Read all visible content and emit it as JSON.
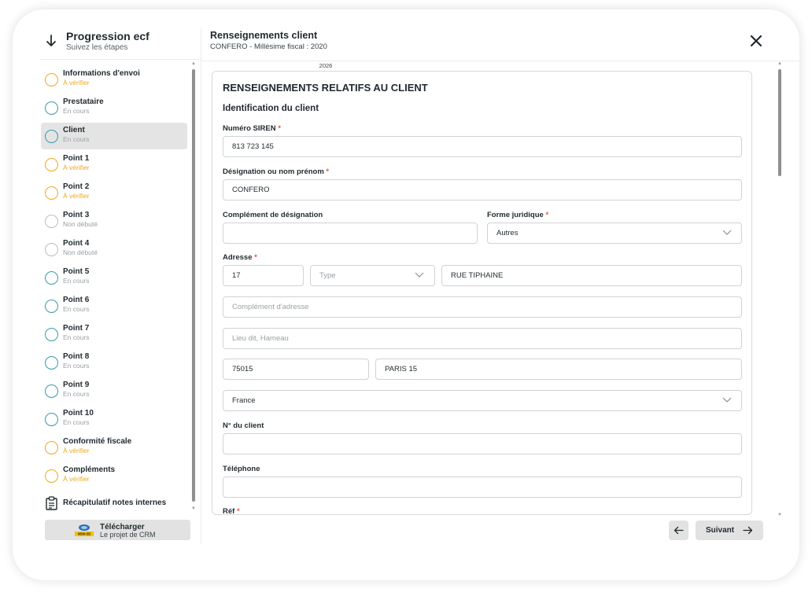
{
  "sidebar": {
    "title": "Progression ecf",
    "subtitle": "Suivez les étapes",
    "steps": [
      {
        "label": "Informations d'envoi",
        "status": "À vérifier",
        "state": "orange"
      },
      {
        "label": "Prestataire",
        "status": "En cours",
        "state": "teal"
      },
      {
        "label": "Client",
        "status": "En cours",
        "state": "teal",
        "active": true
      },
      {
        "label": "Point 1",
        "status": "À vérifier",
        "state": "orange"
      },
      {
        "label": "Point 2",
        "status": "À vérifier",
        "state": "orange"
      },
      {
        "label": "Point 3",
        "status": "Non débuté",
        "state": "grey"
      },
      {
        "label": "Point 4",
        "status": "Non débuté",
        "state": "grey"
      },
      {
        "label": "Point 5",
        "status": "En cours",
        "state": "teal"
      },
      {
        "label": "Point 6",
        "status": "En cours",
        "state": "teal"
      },
      {
        "label": "Point 7",
        "status": "En cours",
        "state": "teal"
      },
      {
        "label": "Point 8",
        "status": "En cours",
        "state": "teal"
      },
      {
        "label": "Point 9",
        "status": "En cours",
        "state": "teal"
      },
      {
        "label": "Point 10",
        "status": "En cours",
        "state": "teal"
      },
      {
        "label": "Conformité fiscale",
        "status": "À vérifier",
        "state": "orange"
      },
      {
        "label": "Compléments",
        "status": "À vérifier",
        "state": "orange"
      }
    ],
    "summary_item": {
      "label": "Récapitulatif notes internes",
      "icon": "clipboard-icon"
    },
    "download": {
      "title": "Télécharger",
      "subtitle": "Le projet de CRM",
      "logo_text": "0000-SD"
    }
  },
  "header": {
    "title": "Renseignements client",
    "subtitle": "CONFERO - Millésime fiscal : 2020"
  },
  "form": {
    "year_tab": "2026",
    "section_title": "RENSEIGNEMENTS RELATIFS AU CLIENT",
    "subsection_title": "Identification du client",
    "required_mark": "*",
    "siren": {
      "label": "Numéro SIREN",
      "value": "813 723 145"
    },
    "designation": {
      "label": "Désignation ou nom prénom",
      "value": "CONFERO"
    },
    "complement_designation": {
      "label": "Complément de désignation",
      "value": ""
    },
    "forme_juridique": {
      "label": "Forme juridique",
      "value": "Autres"
    },
    "adresse": {
      "label": "Adresse",
      "numero": "17",
      "type_placeholder": "Type",
      "voie": "RUE TIPHAINE",
      "complement_placeholder": "Complément d'adresse",
      "lieu_dit_placeholder": "Lieu dit, Hameau",
      "code_postal": "75015",
      "ville": "PARIS 15",
      "pays": "France"
    },
    "numero_client": {
      "label": "N° du client",
      "value": ""
    },
    "telephone": {
      "label": "Téléphone",
      "value": ""
    },
    "ref_label_partial": "Réf"
  },
  "footer": {
    "next_label": "Suivant"
  },
  "colors": {
    "teal": "#3a9aa8",
    "orange": "#f0a81e",
    "grey": "#b9bdbf",
    "required": "#e05a4a"
  }
}
